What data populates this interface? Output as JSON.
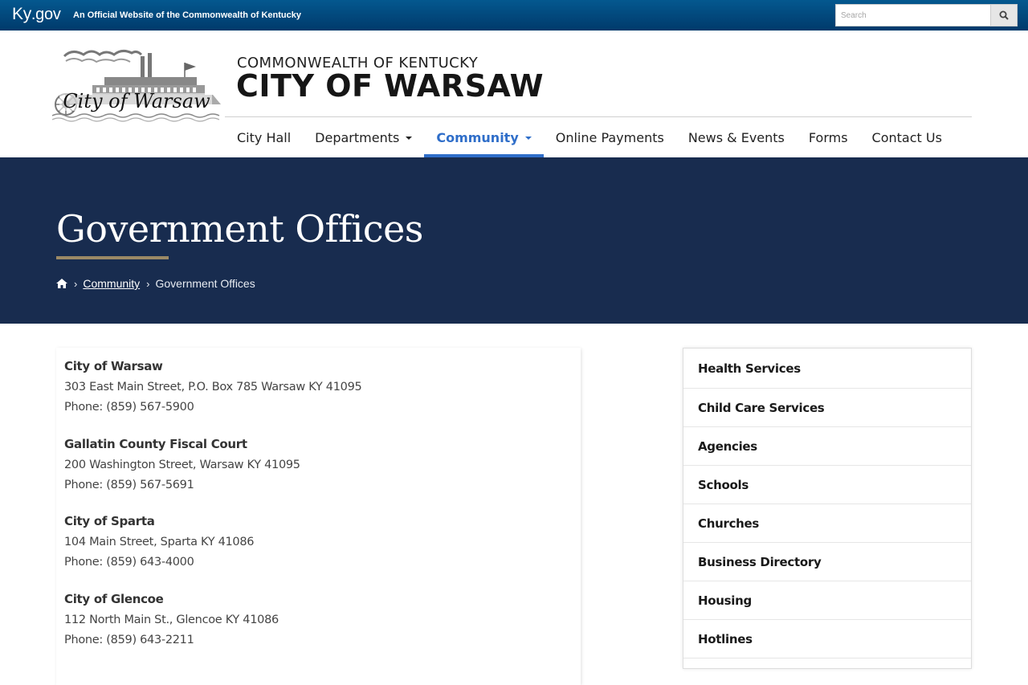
{
  "kybar": {
    "logo_ky": "Ky",
    "logo_gov": ".gov",
    "tagline": "An Official Website of the Commonwealth of Kentucky",
    "search_placeholder": "Search"
  },
  "header": {
    "subtitle": "COMMONWEALTH OF KENTUCKY",
    "title": "CITY OF WARSAW",
    "logo_text": "City of Warsaw",
    "nav": [
      {
        "label": "City Hall",
        "dropdown": false,
        "active": false
      },
      {
        "label": "Departments",
        "dropdown": true,
        "active": false
      },
      {
        "label": "Community",
        "dropdown": true,
        "active": true
      },
      {
        "label": "Online Payments",
        "dropdown": false,
        "active": false
      },
      {
        "label": "News & Events",
        "dropdown": false,
        "active": false
      },
      {
        "label": "Forms",
        "dropdown": false,
        "active": false
      },
      {
        "label": "Contact Us",
        "dropdown": false,
        "active": false
      }
    ]
  },
  "hero": {
    "title": "Government Offices",
    "breadcrumb": {
      "parent": "Community",
      "current": "Government Offices"
    }
  },
  "offices": [
    {
      "name": "City of Warsaw",
      "address": "303 East Main Street, P.O. Box 785 Warsaw KY 41095",
      "phone": "Phone: (859) 567-5900"
    },
    {
      "name": "Gallatin County Fiscal Court",
      "address": "200 Washington Street, Warsaw KY 41095",
      "phone": "Phone: (859) 567-5691"
    },
    {
      "name": "City of Sparta",
      "address": "104 Main Street, Sparta KY 41086",
      "phone": "Phone: (859) 643-4000"
    },
    {
      "name": "City of Glencoe",
      "address": "112 North Main St., Glencoe KY 41086",
      "phone": "Phone: (859) 643-2211"
    }
  ],
  "sidebar": {
    "items": [
      "Health Services",
      "Child Care Services",
      "Agencies",
      "Schools",
      "Churches",
      "Business Directory",
      "Housing",
      "Hotlines"
    ]
  },
  "colors": {
    "kybar": "#003a6b",
    "hero": "#182c4f",
    "accent": "#2f6ec9",
    "rule": "#9b8966"
  }
}
